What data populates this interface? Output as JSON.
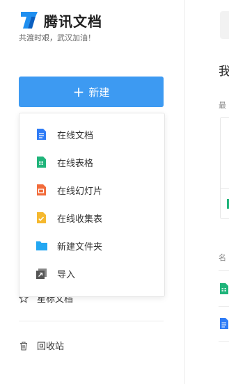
{
  "app": {
    "name": "腾讯文档",
    "slogan": "共渡时艰，武汉加油！",
    "brand_color": "#1f8ff0"
  },
  "sidebar": {
    "new_button": {
      "label": "新建",
      "icon": "plus-icon",
      "color": "#3d9af2"
    },
    "new_menu": [
      {
        "label": "在线文档",
        "icon": "doc-icon",
        "color": "#2f7cf6"
      },
      {
        "label": "在线表格",
        "icon": "sheet-icon",
        "color": "#1fb47a"
      },
      {
        "label": "在线幻灯片",
        "icon": "slide-icon",
        "color": "#f26b3a"
      },
      {
        "label": "在线收集表",
        "icon": "form-icon",
        "color": "#f5b82e"
      },
      {
        "label": "新建文件夹",
        "icon": "folder-icon",
        "color": "#23a7f2"
      },
      {
        "label": "导入",
        "icon": "import-icon",
        "color": "#555555"
      }
    ],
    "items": [
      {
        "label": "星标文档",
        "icon": "star-icon"
      },
      {
        "label": "回收站",
        "icon": "trash-icon"
      }
    ]
  },
  "main": {
    "title": "我",
    "recent_label": "最",
    "name_header": "名"
  }
}
